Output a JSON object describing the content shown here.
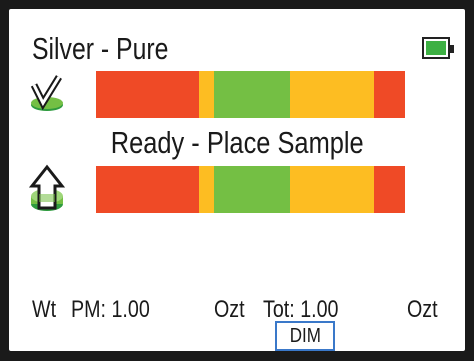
{
  "header": {
    "title": "Silver - Pure",
    "battery_icon": "battery-full-icon",
    "battery_level": 1.0,
    "battery_color": "#3db043"
  },
  "status": {
    "message": "Ready - Place Sample"
  },
  "colors": {
    "red": "#ef4a26",
    "yellow": "#fdbd22",
    "green": "#74bf44"
  },
  "bars": [
    {
      "name": "purity-match-bar",
      "icon": "check-on-disc-icon",
      "segments": [
        {
          "color": "red",
          "fraction": 0.333
        },
        {
          "color": "yellow",
          "fraction": 0.049
        },
        {
          "color": "green",
          "fraction": 0.246
        },
        {
          "color": "yellow",
          "fraction": 0.272
        },
        {
          "color": "red",
          "fraction": 0.1
        }
      ]
    },
    {
      "name": "sample-position-bar",
      "icon": "lift-arrow-disc-icon",
      "segments": [
        {
          "color": "red",
          "fraction": 0.333
        },
        {
          "color": "yellow",
          "fraction": 0.049
        },
        {
          "color": "green",
          "fraction": 0.246
        },
        {
          "color": "yellow",
          "fraction": 0.272
        },
        {
          "color": "red",
          "fraction": 0.1
        }
      ]
    }
  ],
  "footer": {
    "wt_label": "Wt",
    "pm_label": "PM: 1.00",
    "pm_unit": "Ozt",
    "tot_label": "Tot: 1.00",
    "tot_unit": "Ozt",
    "dim_button": "DIM"
  }
}
